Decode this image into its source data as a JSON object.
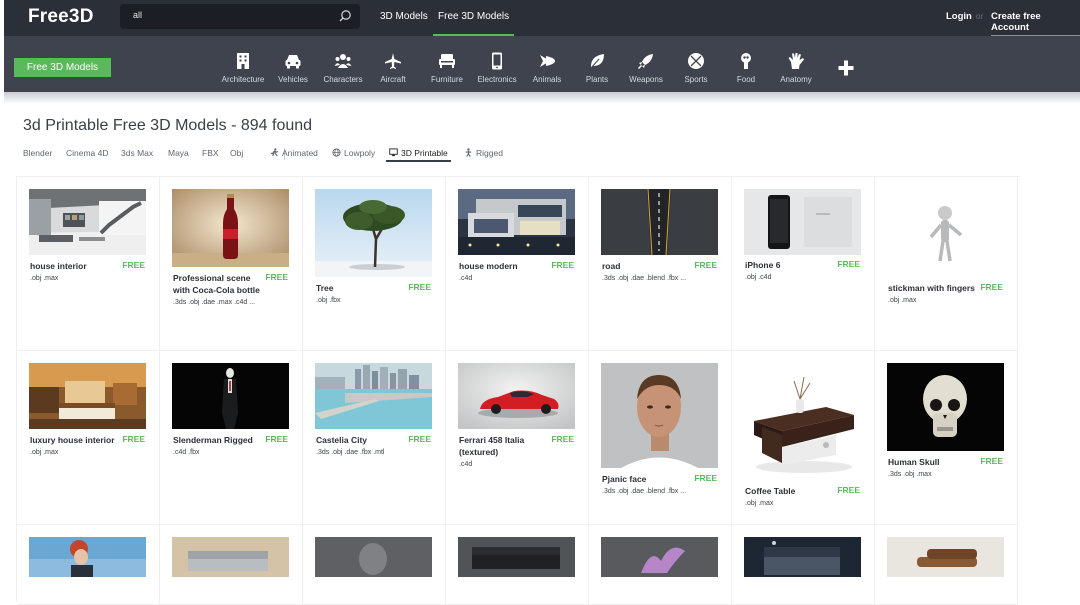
{
  "topbar": {
    "logo": "Free3D",
    "search_value": "all",
    "tabs": [
      "3D Models",
      "Free 3D Models"
    ],
    "login": "Login",
    "or": "or",
    "create_account": "Create free Account"
  },
  "catbar": {
    "free_button": "Free 3D Models",
    "categories": [
      "Architecture",
      "Vehicles",
      "Characters",
      "Aircraft",
      "Furniture",
      "Electronics",
      "Animals",
      "Plants",
      "Weapons",
      "Sports",
      "Food",
      "Anatomy"
    ]
  },
  "heading": {
    "title": "3d Printable Free 3D Models - ",
    "count": "894 found"
  },
  "filters": {
    "formats": [
      "Blender",
      "Cinema 4D",
      "3ds Max",
      "Maya",
      "FBX",
      "Obj"
    ],
    "types": [
      "Animated",
      "Lowpoly",
      "3D Printable",
      "Rigged"
    ]
  },
  "free_label": "FREE",
  "models": [
    {
      "name": "house interior",
      "formats": ".obj .max"
    },
    {
      "name": "Professional scene with Coca-Cola bottle",
      "formats": ".3ds .obj .dae .max .c4d ..."
    },
    {
      "name": "Tree",
      "formats": ".obj .fbx"
    },
    {
      "name": "house modern",
      "formats": ".c4d"
    },
    {
      "name": "road",
      "formats": ".3ds .obj .dae .blend .fbx ..."
    },
    {
      "name": "iPhone 6",
      "formats": ".obj .c4d"
    },
    {
      "name": "stickman with fingers",
      "formats": ".obj .max"
    },
    {
      "name": "luxury house interior",
      "formats": ".obj .max"
    },
    {
      "name": "Slenderman Rigged",
      "formats": ".c4d .fbx"
    },
    {
      "name": "Castelia City",
      "formats": ".3ds .obj .dae .fbx .mtl"
    },
    {
      "name": "Ferrari 458 Italia (textured)",
      "formats": ".c4d"
    },
    {
      "name": "Pjanic face",
      "formats": ".3ds .obj .dae .blend .fbx ..."
    },
    {
      "name": "Coffee Table",
      "formats": ".obj .max"
    },
    {
      "name": "Human Skull",
      "formats": ".3ds .obj .max"
    }
  ],
  "colors": {
    "topbar": "#2b2f38",
    "catbar": "#3e434d",
    "accent": "#5cb85c"
  }
}
